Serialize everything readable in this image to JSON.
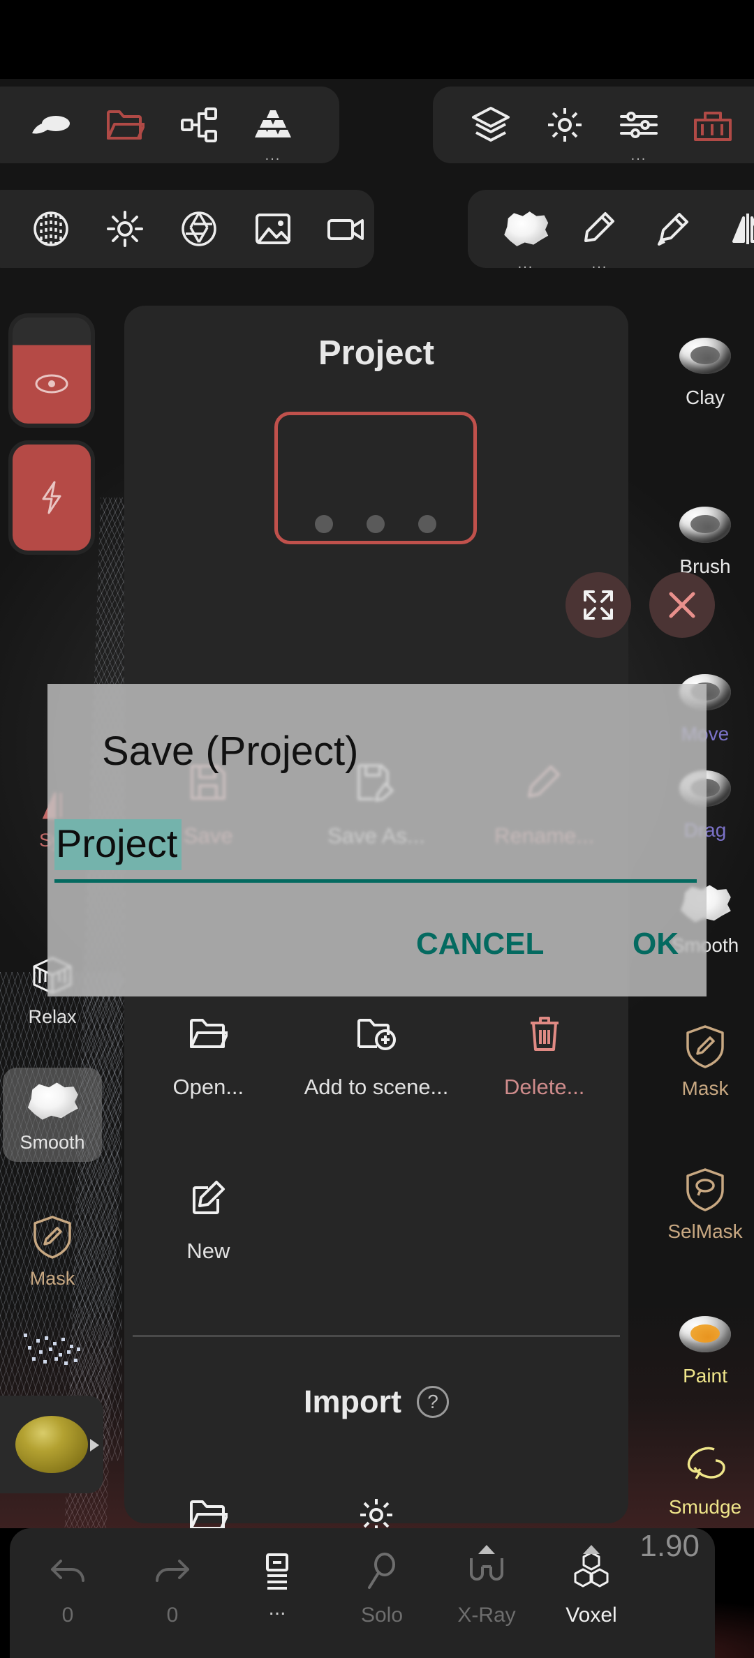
{
  "app": {
    "version": "1.90"
  },
  "toolbar_top_left": [
    {
      "name": "sculpt-clay-icon",
      "label": ""
    },
    {
      "name": "folder-open-icon",
      "label": ""
    },
    {
      "name": "scene-graph-icon",
      "label": ""
    },
    {
      "name": "topology-icon",
      "label": "",
      "overflow": "..."
    }
  ],
  "toolbar_top_right": [
    {
      "name": "layers-icon",
      "label": ""
    },
    {
      "name": "settings-gear-icon",
      "label": ""
    },
    {
      "name": "sliders-icon",
      "label": "",
      "overflow": "..."
    },
    {
      "name": "toolbox-icon",
      "label": ""
    }
  ],
  "toolbar_row2_left": [
    {
      "name": "matcap-grid-icon",
      "label": ""
    },
    {
      "name": "brightness-sun-icon",
      "label": ""
    },
    {
      "name": "aperture-icon",
      "label": ""
    },
    {
      "name": "image-icon",
      "label": ""
    },
    {
      "name": "video-camera-icon",
      "label": ""
    }
  ],
  "toolbar_row2_right": [
    {
      "name": "brush-stone-icon",
      "label": "",
      "overflow": "..."
    },
    {
      "name": "pen-stroke-icon",
      "label": "",
      "overflow": "..."
    },
    {
      "name": "paint-roller-icon",
      "label": ""
    },
    {
      "name": "mirror-symmetry-icon",
      "label": ""
    }
  ],
  "left_column": {
    "radius_pill": {
      "name": "radius-pill",
      "icon": "radius-circle-icon"
    },
    "intensity_pill": {
      "name": "intensity-pill",
      "icon": "lightning-bolt-icon"
    },
    "symmetry": {
      "label": "Sym",
      "icon": "symmetry-triangle-icon"
    },
    "tools": [
      {
        "label": "Relax",
        "icon": "relax-cage-icon",
        "selected": false
      },
      {
        "label": "Smooth",
        "icon": "smooth-stone-icon",
        "selected": true
      },
      {
        "label": "Mask",
        "icon": "mask-shield-icon",
        "selected": false
      }
    ],
    "material_swatch": {
      "name": "material-swatch",
      "color": "#9a8b27"
    }
  },
  "right_column": {
    "tools": [
      {
        "label": "Clay",
        "icon": "clay-blob-icon"
      },
      {
        "label": "Brush",
        "icon": "brush-blob-icon"
      },
      {
        "label": "Move",
        "icon": "move-blob-icon"
      },
      {
        "label": "Drag",
        "icon": "drag-blob-icon"
      },
      {
        "label": "Smooth",
        "icon": "smooth-stone-icon"
      },
      {
        "label": "Mask",
        "icon": "mask-shield-icon"
      },
      {
        "label": "SelMask",
        "icon": "selmask-shield-icon"
      },
      {
        "label": "Paint",
        "icon": "paint-blob-icon"
      },
      {
        "label": "Smudge",
        "icon": "smudge-finger-icon"
      }
    ]
  },
  "project_panel": {
    "title": "Project",
    "expand_button": {
      "name": "expand-button",
      "icon": "expand-arrows-icon"
    },
    "close_button": {
      "name": "close-button",
      "icon": "close-x-icon"
    },
    "file_actions": [
      {
        "label": "Save",
        "icon": "floppy-save-icon",
        "dim": true
      },
      {
        "label": "Save As...",
        "icon": "floppy-save-as-icon",
        "dim": false
      },
      {
        "label": "Rename...",
        "icon": "pencil-rename-icon",
        "dim": true
      }
    ],
    "manage_actions": [
      {
        "label": "Open...",
        "icon": "folder-open-icon",
        "dim": false
      },
      {
        "label": "Add to scene...",
        "icon": "folder-plus-icon",
        "dim": false
      },
      {
        "label": "Delete...",
        "icon": "trash-delete-icon",
        "dim": true
      }
    ],
    "new_action": {
      "label": "New",
      "icon": "new-document-pencil-icon"
    },
    "import": {
      "title": "Import",
      "help": "?"
    }
  },
  "dialog": {
    "title": "Save (Project)",
    "input_value": "Project",
    "cancel_label": "CANCEL",
    "ok_label": "OK",
    "accent": "#046A60",
    "selection_color": "#74b3ac"
  },
  "bottom_bar": {
    "items": [
      {
        "label": "0",
        "icon": "undo-arrow-icon",
        "dim": true
      },
      {
        "label": "0",
        "icon": "redo-arrow-icon",
        "dim": true
      },
      {
        "label": "",
        "icon": "layers-list-icon",
        "dim": false,
        "overflow": "..."
      },
      {
        "label": "Solo",
        "icon": "solo-magnifier-icon",
        "dim": true
      },
      {
        "label": "X-Ray",
        "icon": "xray-glasses-icon",
        "dim": true
      },
      {
        "label": "Voxel",
        "icon": "voxel-cubes-icon",
        "dim": false
      }
    ],
    "version": "1.90"
  }
}
